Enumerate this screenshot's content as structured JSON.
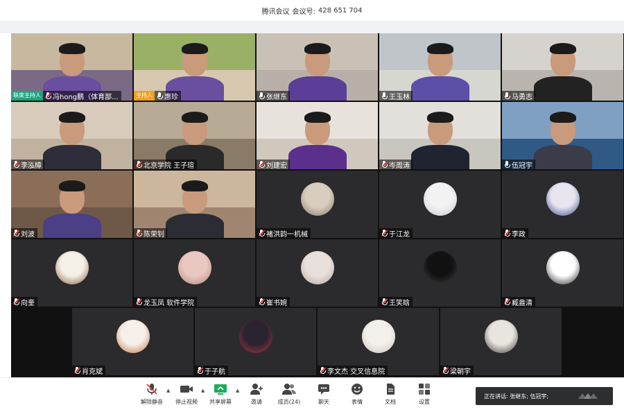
{
  "window": {
    "app_title": "腾讯会议",
    "meeting_label": "会议号:",
    "meeting_id": "428 651 704"
  },
  "tiles": [
    {
      "name": "冯hong鹏（体育部...",
      "badge": "联席主持人",
      "badge_type": "cohost",
      "mic": "muted",
      "kind": "video",
      "bg": "#c8b8a0",
      "bg2": "#7a6a86",
      "shirt": "#6a4fa0"
    },
    {
      "name": "惠珍",
      "badge": "主持人",
      "badge_type": "host",
      "mic": "on",
      "kind": "video",
      "bg": "#9bb067",
      "bg2": "#d8c8b0",
      "shirt": "#6a4fa0"
    },
    {
      "name": "张继东",
      "mic": "on",
      "kind": "video",
      "bg": "#c9c1b6",
      "bg2": "#b8b0a8",
      "shirt": "#5b3e98"
    },
    {
      "name": "王玉林",
      "mic": "on",
      "kind": "video",
      "bg": "#bfc5c8",
      "bg2": "#d7d7d2",
      "shirt": "#5b4fa8"
    },
    {
      "name": "马勇志",
      "mic": "on",
      "kind": "video",
      "bg": "#d6d3ce",
      "bg2": "#b9b4ae",
      "shirt": "#222222"
    },
    {
      "name": "李泓樟",
      "mic": "muted",
      "kind": "video",
      "bg": "#d8cbbb",
      "bg2": "#c1b2a0",
      "shirt": "#2e2e3a"
    },
    {
      "name": "北京学院 王子瑄",
      "mic": "muted",
      "kind": "video",
      "bg": "#b8ab96",
      "bg2": "#8a7a68",
      "shirt": "#2a2a2a"
    },
    {
      "name": "刘建宏",
      "mic": "muted",
      "kind": "video",
      "bg": "#e7e3dc",
      "bg2": "#d0c8bc",
      "shirt": "#5b2f8c"
    },
    {
      "name": "岑周涛",
      "mic": "muted",
      "kind": "video",
      "bg": "#e3e0dc",
      "bg2": "#c9c5bf",
      "shirt": "#1f2430"
    },
    {
      "name": "伍冠宇",
      "mic": "on",
      "kind": "video",
      "bg": "#7fa0c3",
      "bg2": "#2f5a86",
      "shirt": "#3b3b4a"
    },
    {
      "name": "刘波",
      "mic": "muted",
      "kind": "video",
      "bg": "#8a6e58",
      "bg2": "#6e5848",
      "shirt": "#4b3f86"
    },
    {
      "name": "陈荣钊",
      "mic": "muted",
      "kind": "video",
      "bg": "#cdb79c",
      "bg2": "#a08670",
      "shirt": "#2c2c34"
    },
    {
      "name": "褚洪韵一机械",
      "mic": "muted",
      "kind": "avatar",
      "av1": "#d9cdbf",
      "av2": "#8a7a6c"
    },
    {
      "name": "于江龙",
      "mic": "muted",
      "kind": "avatar",
      "av1": "#f2f2f2",
      "av2": "#c9c9c9"
    },
    {
      "name": "李政",
      "mic": "muted",
      "kind": "avatar",
      "av1": "#e8e4f0",
      "av2": "#3a4a86"
    },
    {
      "name": "向奎",
      "mic": "muted",
      "kind": "avatar",
      "av1": "#f4f0e8",
      "av2": "#8a5a3a"
    },
    {
      "name": "龙玉凤 软件学院",
      "mic": "muted",
      "kind": "avatar",
      "av1": "#e8c8c0",
      "av2": "#b58a7a"
    },
    {
      "name": "崔书婉",
      "mic": "muted",
      "kind": "avatar",
      "av1": "#e8e0dc",
      "av2": "#b8a8a0"
    },
    {
      "name": "王笑晗",
      "mic": "muted",
      "kind": "avatar",
      "av1": "#111111",
      "av2": "#444444"
    },
    {
      "name": "臧盎清",
      "mic": "muted",
      "kind": "avatar",
      "av1": "#ffffff",
      "av2": "#222222"
    },
    {
      "name": "肖克斌",
      "mic": "muted",
      "kind": "avatar",
      "av1": "#f5f0ea",
      "av2": "#c0703a"
    },
    {
      "name": "于子航",
      "mic": "muted",
      "kind": "avatar",
      "av1": "#2a2430",
      "av2": "#b83040"
    },
    {
      "name": "李文杰 交叉信息院",
      "mic": "muted",
      "kind": "avatar",
      "av1": "#f3f0ec",
      "av2": "#c9c2ba"
    },
    {
      "name": "梁朝宇",
      "mic": "muted",
      "kind": "avatar",
      "av1": "#e8e4de",
      "av2": "#3a3a3a"
    }
  ],
  "toolbar": {
    "unmute": "解除静音",
    "stop_video": "停止视频",
    "share_screen": "共享屏幕",
    "invite": "邀请",
    "members": "成员(24)",
    "chat": "聊天",
    "reactions": "表情",
    "docs": "文档",
    "settings": "设置"
  },
  "speaking": {
    "text": "正在讲话: 张继东; 伍冠宇;"
  },
  "colors": {
    "cohost_badge": "#1ea37c",
    "host_badge": "#f0a020",
    "share_green": "#1aad5a",
    "muted_red": "#e23a3a"
  }
}
